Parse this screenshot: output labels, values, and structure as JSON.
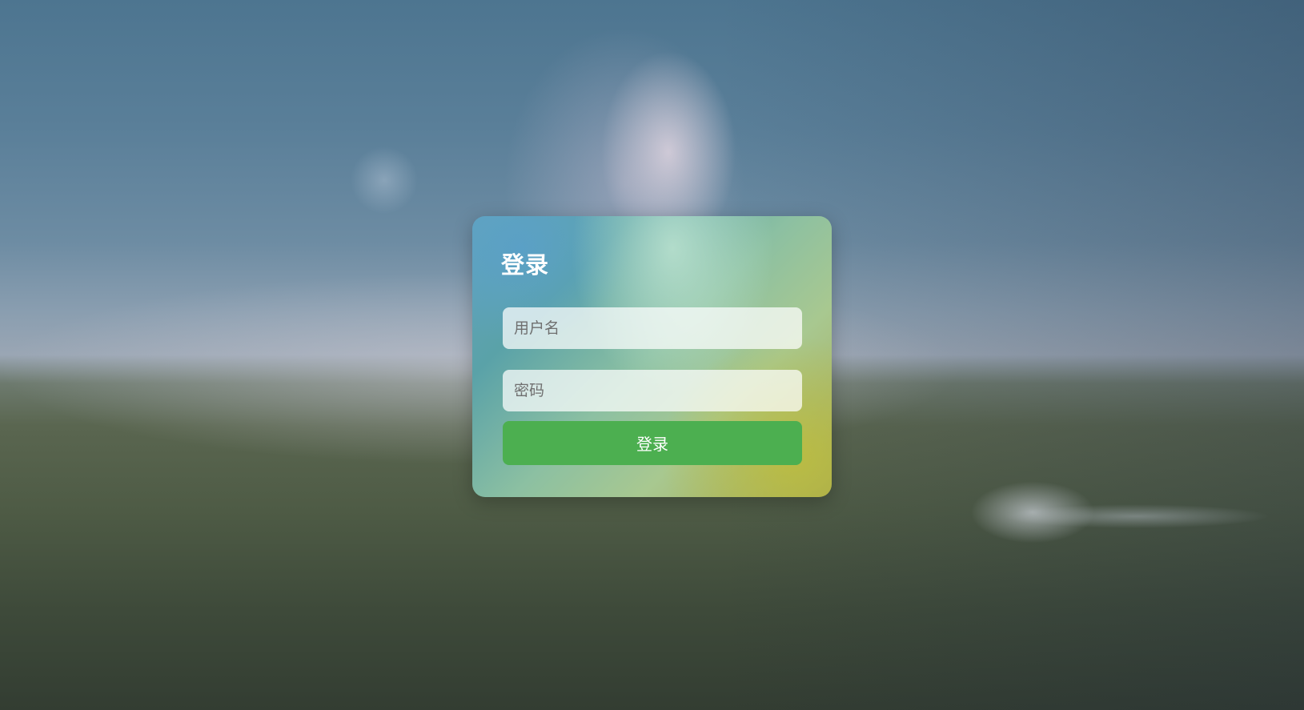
{
  "login": {
    "title": "登录",
    "username_placeholder": "用户名",
    "password_placeholder": "密码",
    "submit_label": "登录"
  },
  "colors": {
    "submit_button": "#4caf50",
    "title_text": "#ffffff"
  }
}
